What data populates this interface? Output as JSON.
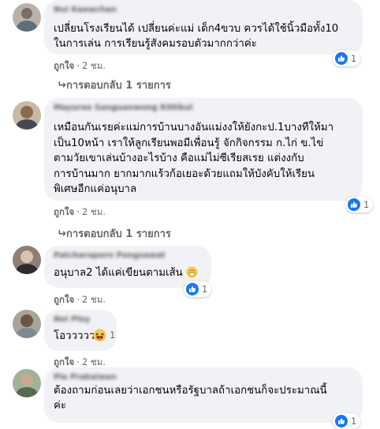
{
  "comments": [
    {
      "author": "Nui Kaewchan",
      "lines": [
        "เปลี่ยนโรงเรียนได้ เปลี่ยนค่ะแม่ เด็ก4ขวบ ควรได้ใช้นิ้วมือทั้ง10",
        "ในการเล่น การเรียนรู้สังคมรอบตัวมากกว่าค่ะ"
      ],
      "like_label": "ถูกใจ",
      "time": "2 ชม.",
      "reaction_count": "1",
      "reply_label": "การตอบกลับ 1 รายการ"
    },
    {
      "author": "Mayuree Sanguanwong Kittikul",
      "lines": [
        "เหมือนกันเรยค่ะแม่การบ้านบางอันแม่งงให้ยังกะป.1บางทีให้มา",
        "เป็น10หน้า เราให้ลูกเรียนพอมีเพื่อนรู้ จักกิจกรรม ก.ไก่ ข.ไข่",
        "ตามวัยเขาเล่นบ้างอะไรบ้าง คือแม่ไม่ซีเรียสเรย แต่งงกับ",
        "การบ้านมาก ยากมากแร้วก้อเยอะด้วยแถมให้บังคับให้เรียน",
        "พิเศษอีกแค่อนุบาล"
      ],
      "like_label": "ถูกใจ",
      "time": "2 ชม.",
      "reaction_count": "1",
      "reply_label": "การตอบกลับ 1 รายการ"
    },
    {
      "author": "Patcharaporn Pongsawat",
      "lines": [
        "อนุบาล2 ได้แค่เขียนตามเส้น"
      ],
      "like_label": "ถูกใจ",
      "time": "2 ชม.",
      "reaction_count": "1"
    },
    {
      "author": "Noi Ploy",
      "lines": [
        "โอววววว"
      ],
      "like_label": "ถูกใจ",
      "time": "2 ชม.",
      "reaction_count": "1"
    },
    {
      "author": "Pla Prakaiwan",
      "lines": [
        "ต้องถามก่อนเลยว่าเอกชนหรือรัฐบาลถ้าเอกชนก็จะประมาณนี้",
        "ค่ะ"
      ],
      "reaction_count": "1"
    }
  ],
  "colors": {
    "bubble": "#f0f2f5",
    "meta": "#65676b",
    "like_blue": "#1877f2"
  },
  "icons": [
    "like-icon",
    "haha-icon",
    "grin-emoji",
    "reply-arrow-icon"
  ]
}
